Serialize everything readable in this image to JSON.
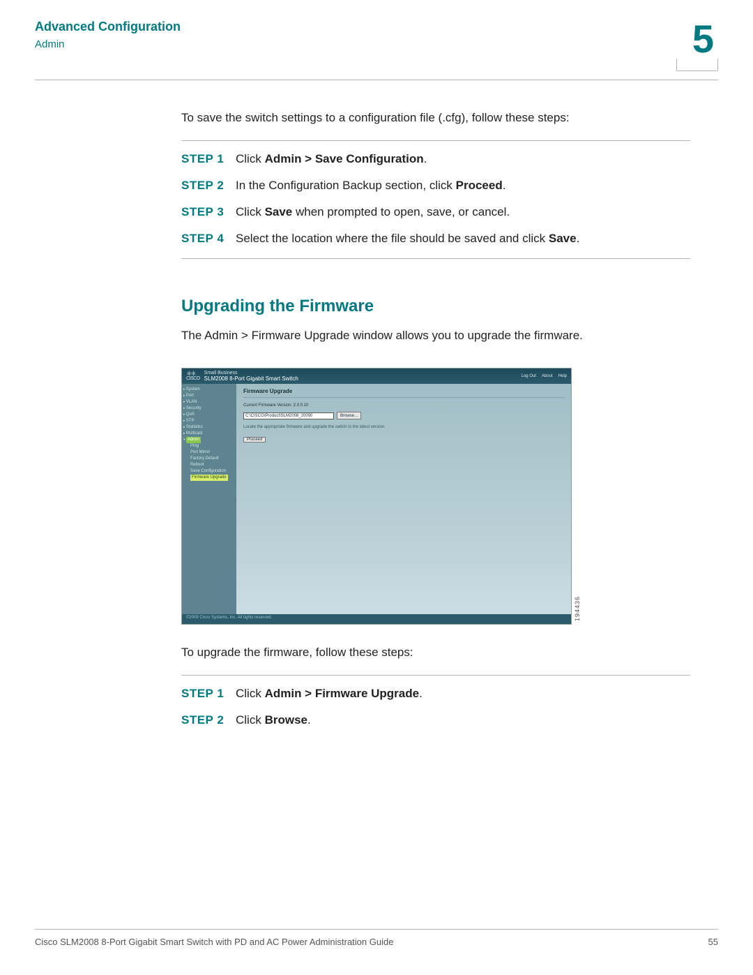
{
  "header": {
    "chapter_title": "Advanced Configuration",
    "subsection": "Admin",
    "chapter_number": "5"
  },
  "save_cfg": {
    "intro": "To save the switch settings to a configuration file (.cfg), follow these steps:",
    "steps": [
      {
        "label": "STEP 1",
        "pre": "Click ",
        "bold": "Admin > Save Configuration",
        "post": "."
      },
      {
        "label": "STEP 2",
        "pre": "In the Configuration Backup section, click ",
        "bold": "Proceed",
        "post": "."
      },
      {
        "label": "STEP 3",
        "pre": "Click ",
        "bold": "Save",
        "post": " when prompted to open, save, or cancel."
      },
      {
        "label": "STEP 4",
        "pre": "Select the location where the file should be saved and click ",
        "bold": "Save",
        "post": "."
      }
    ]
  },
  "upgrade": {
    "heading": "Upgrading the Firmware",
    "intro": "The Admin > Firmware Upgrade window allows you to upgrade the firmware.",
    "after_image": "To upgrade the firmware, follow these steps:",
    "steps": [
      {
        "label": "STEP 1",
        "pre": "Click ",
        "bold": "Admin > Firmware Upgrade",
        "post": "."
      },
      {
        "label": "STEP 2",
        "pre": "Click ",
        "bold": "Browse",
        "post": "."
      }
    ]
  },
  "screenshot": {
    "brand_line1": "Small Business",
    "brand_line2": "SLM2008 8-Port Gigabit Smart Switch",
    "top_links": [
      "Log Out",
      "About",
      "Help"
    ],
    "nav": [
      "System",
      "Port",
      "VLAN",
      "Security",
      "QoS",
      "STP",
      "Statistics",
      "Multicast"
    ],
    "nav_open": "Admin",
    "nav_sub": [
      "Ping",
      "Port Mirror",
      "Factory Default",
      "Reboot",
      "Save Configuration"
    ],
    "nav_active": "Firmware Upgrade",
    "panel_title": "Firmware Upgrade",
    "fw_version": "Current Firmware Version: 2.0.0.10",
    "path_value": "C:\\CISCO\\Product\\SLM2008_20090",
    "browse_label": "Browse...",
    "hint": "Locate the appropriate firmware and upgrade the switch to the latest version.",
    "proceed_label": "Proceed",
    "copyright": "©2009 Cisco Systems, Inc. All rights reserved.",
    "image_number": "194436"
  },
  "footer": {
    "doc_title": "Cisco SLM2008 8-Port Gigabit Smart Switch with PD and AC Power Administration Guide",
    "page_number": "55"
  }
}
